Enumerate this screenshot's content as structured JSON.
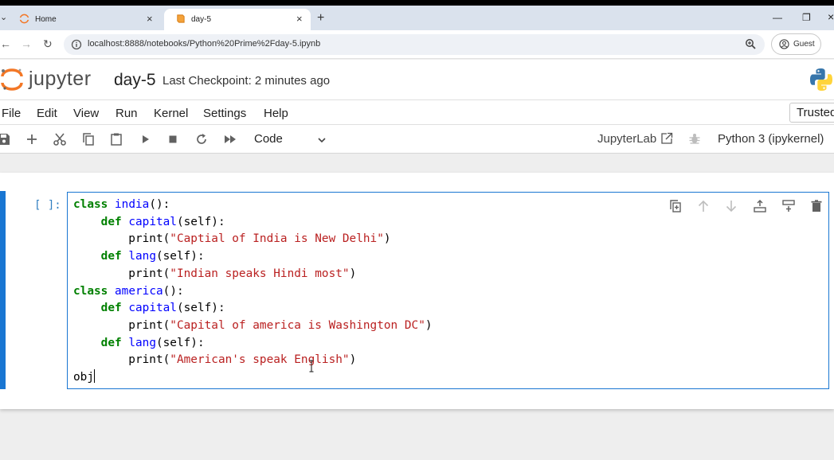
{
  "browser": {
    "tabs": [
      {
        "title": "Home",
        "active": false
      },
      {
        "title": "day-5",
        "active": true
      }
    ],
    "url": "localhost:8888/notebooks/Python%20Prime%2Fday-5.ipynb",
    "profile_label": "Guest"
  },
  "header": {
    "wordmark": "jupyter",
    "notebook_title": "day-5",
    "checkpoint": "Last Checkpoint: 2 minutes ago"
  },
  "menu": {
    "items": [
      "File",
      "Edit",
      "View",
      "Run",
      "Kernel",
      "Settings",
      "Help"
    ],
    "trusted_label": "Trusted"
  },
  "toolbar": {
    "cell_type": "Code",
    "jupyterlab_label": "JupyterLab",
    "kernel": "Python 3 (ipykernel)"
  },
  "cell": {
    "prompt": "[ ]:",
    "code_lines": [
      [
        [
          "kw",
          "class"
        ],
        [
          "t",
          " "
        ],
        [
          "nm",
          "india"
        ],
        [
          "t",
          "():"
        ]
      ],
      [
        [
          "t",
          "    "
        ],
        [
          "kw",
          "def"
        ],
        [
          "t",
          " "
        ],
        [
          "nm",
          "capital"
        ],
        [
          "t",
          "(self):"
        ]
      ],
      [
        [
          "t",
          "        print("
        ],
        [
          "st",
          "\"Captial of India is New Delhi\""
        ],
        [
          "t",
          ")"
        ]
      ],
      [
        [
          "t",
          "    "
        ],
        [
          "kw",
          "def"
        ],
        [
          "t",
          " "
        ],
        [
          "nm",
          "lang"
        ],
        [
          "t",
          "(self):"
        ]
      ],
      [
        [
          "t",
          "        print("
        ],
        [
          "st",
          "\"Indian speaks Hindi most\""
        ],
        [
          "t",
          ")"
        ]
      ],
      [
        [
          "kw",
          "class"
        ],
        [
          "t",
          " "
        ],
        [
          "nm",
          "america"
        ],
        [
          "t",
          "():"
        ]
      ],
      [
        [
          "t",
          "    "
        ],
        [
          "kw",
          "def"
        ],
        [
          "t",
          " "
        ],
        [
          "nm",
          "capital"
        ],
        [
          "t",
          "(self):"
        ]
      ],
      [
        [
          "t",
          "        print("
        ],
        [
          "st",
          "\"Capital of america is Washington DC\""
        ],
        [
          "t",
          ")"
        ]
      ],
      [
        [
          "t",
          "    "
        ],
        [
          "kw",
          "def"
        ],
        [
          "t",
          " "
        ],
        [
          "nm",
          "lang"
        ],
        [
          "t",
          "(self):"
        ]
      ],
      [
        [
          "t",
          "        print("
        ],
        [
          "st",
          "\"American's speak English\""
        ],
        [
          "t",
          ")"
        ]
      ],
      [
        [
          "t",
          "obj"
        ],
        [
          "caret",
          ""
        ]
      ]
    ]
  },
  "colors": {
    "accent": "#1976d2",
    "keyword": "#008000",
    "name": "#0000ff",
    "string": "#ba2121",
    "jupyter_orange": "#f37726"
  }
}
